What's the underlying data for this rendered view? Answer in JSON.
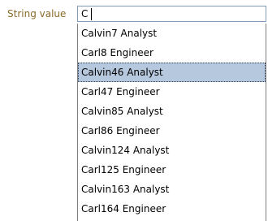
{
  "field": {
    "label": "String value",
    "value": "C"
  },
  "dropdown": {
    "options": [
      {
        "label": "Calvin7 Analyst",
        "selected": false
      },
      {
        "label": "Carl8 Engineer",
        "selected": false
      },
      {
        "label": "Calvin46 Analyst",
        "selected": true
      },
      {
        "label": "Carl47 Engineer",
        "selected": false
      },
      {
        "label": "Calvin85 Analyst",
        "selected": false
      },
      {
        "label": "Carl86 Engineer",
        "selected": false
      },
      {
        "label": "Calvin124 Analyst",
        "selected": false
      },
      {
        "label": "Carl125 Engineer",
        "selected": false
      },
      {
        "label": "Calvin163 Analyst",
        "selected": false
      },
      {
        "label": "Carl164 Engineer",
        "selected": false
      }
    ]
  },
  "colors": {
    "label_text": "#8a6a2a",
    "input_border": "#7f9db9",
    "selected_bg": "#b6c8dd"
  }
}
